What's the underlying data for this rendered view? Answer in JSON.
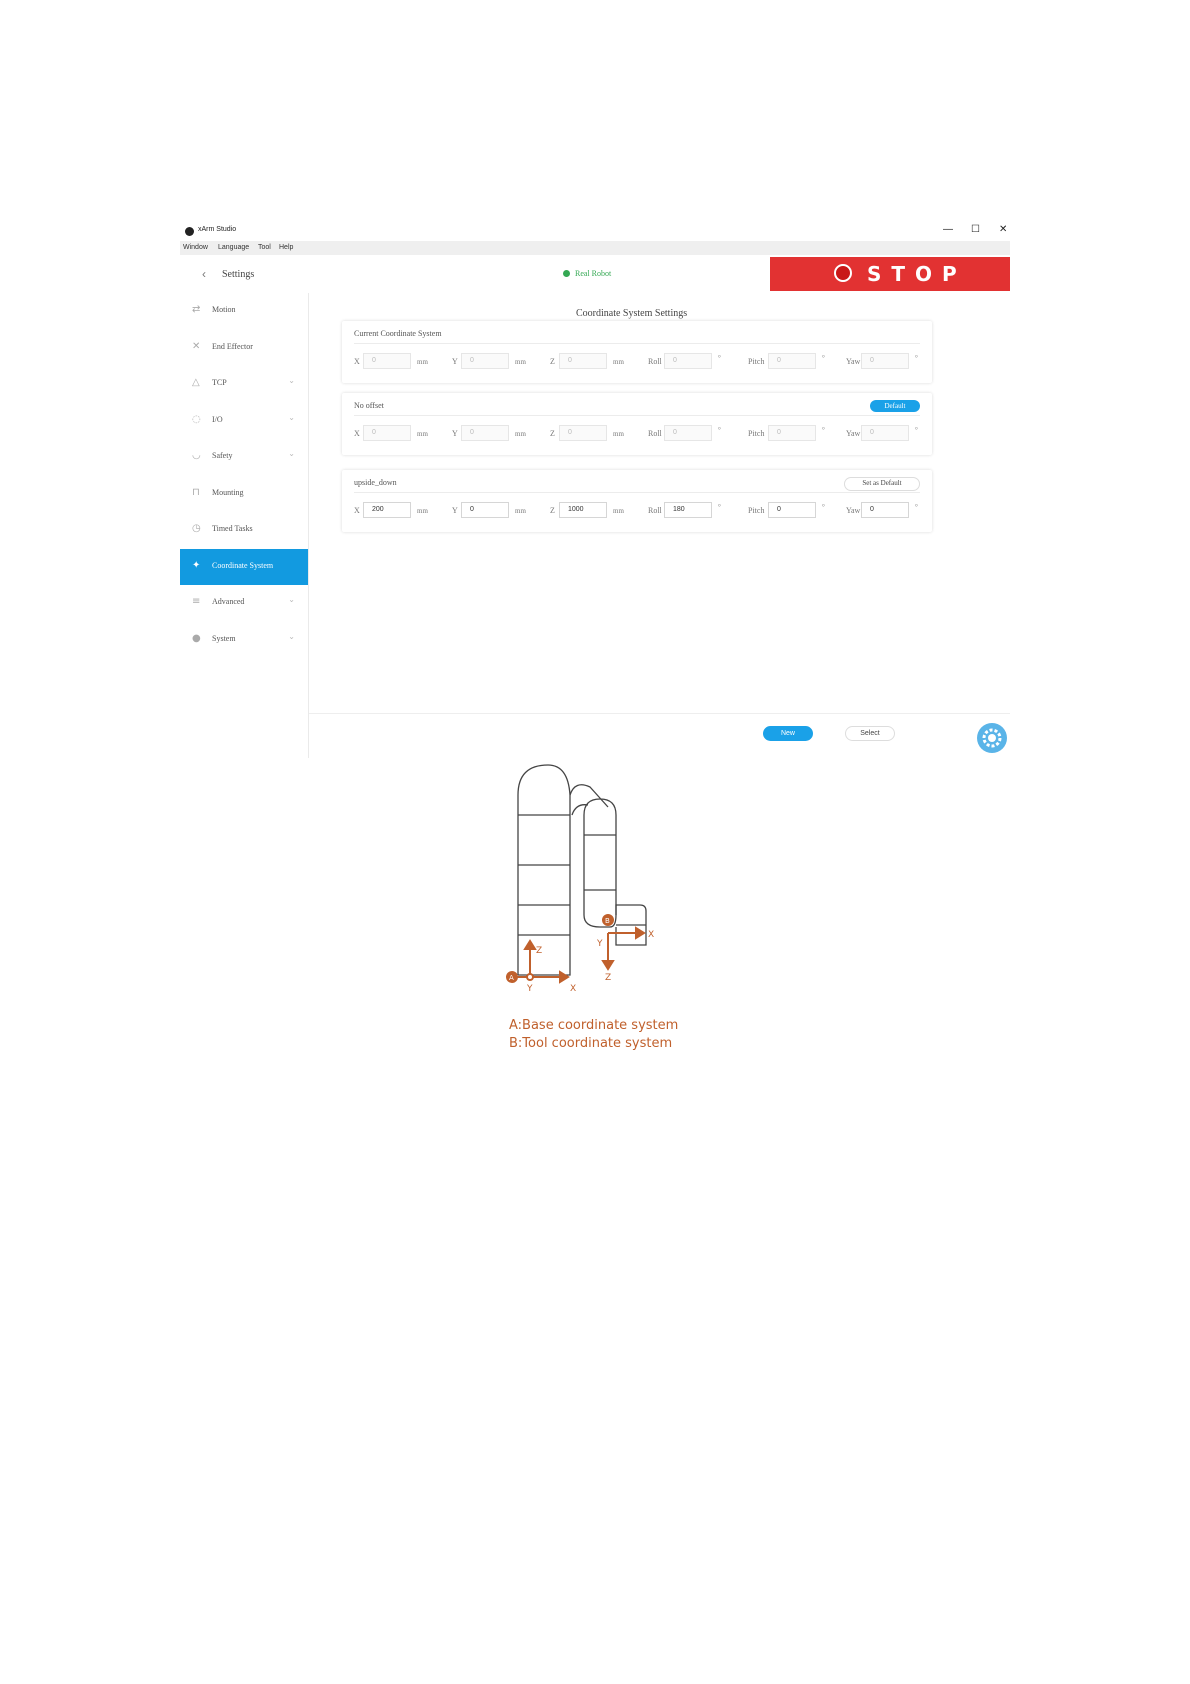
{
  "window": {
    "app_title": "xArm Studio",
    "minimize_glyph": "—",
    "maximize_glyph": "☐",
    "close_glyph": "✕"
  },
  "menu": [
    "Window",
    "Language",
    "Tool",
    "Help"
  ],
  "header": {
    "back_glyph": "‹",
    "settings_label": "Settings",
    "status_text": "Real Robot",
    "stop_label": "STOP"
  },
  "sidebar": {
    "items": [
      {
        "label": "Motion",
        "icon": "motion-icon",
        "chevron": false,
        "active": false
      },
      {
        "label": "End Effector",
        "icon": "end-effector-icon",
        "chevron": false,
        "active": false
      },
      {
        "label": "TCP",
        "icon": "tcp-icon",
        "chevron": true,
        "active": false
      },
      {
        "label": "I/O",
        "icon": "io-icon",
        "chevron": true,
        "active": false
      },
      {
        "label": "Safety",
        "icon": "safety-icon",
        "chevron": true,
        "active": false
      },
      {
        "label": "Mounting",
        "icon": "mounting-icon",
        "chevron": false,
        "active": false
      },
      {
        "label": "Timed Tasks",
        "icon": "clock-icon",
        "chevron": false,
        "active": false
      },
      {
        "label": "Coordinate System",
        "icon": "coordinate-icon",
        "chevron": false,
        "active": true
      },
      {
        "label": "Advanced",
        "icon": "advanced-icon",
        "chevron": true,
        "active": false
      },
      {
        "label": "System",
        "icon": "info-icon",
        "chevron": true,
        "active": false
      }
    ]
  },
  "main": {
    "title": "Coordinate System Settings",
    "cards": [
      {
        "title": "Current Coordinate System",
        "button": "",
        "fields": [
          {
            "label": "X",
            "value": "0",
            "unit": "mm"
          },
          {
            "label": "Y",
            "value": "0",
            "unit": "mm"
          },
          {
            "label": "Z",
            "value": "0",
            "unit": "mm"
          },
          {
            "label": "Roll",
            "value": "0",
            "unit": "°"
          },
          {
            "label": "Pitch",
            "value": "0",
            "unit": "°"
          },
          {
            "label": "Yaw",
            "value": "0",
            "unit": "°"
          }
        ]
      },
      {
        "title": "No offset",
        "button": "Default",
        "fields": [
          {
            "label": "X",
            "value": "0",
            "unit": "mm"
          },
          {
            "label": "Y",
            "value": "0",
            "unit": "mm"
          },
          {
            "label": "Z",
            "value": "0",
            "unit": "mm"
          },
          {
            "label": "Roll",
            "value": "0",
            "unit": "°"
          },
          {
            "label": "Pitch",
            "value": "0",
            "unit": "°"
          },
          {
            "label": "Yaw",
            "value": "0",
            "unit": "°"
          }
        ]
      },
      {
        "title": "upside_down",
        "button": "Set as Default",
        "fields": [
          {
            "label": "X",
            "value": "200",
            "unit": "mm"
          },
          {
            "label": "Y",
            "value": "0",
            "unit": "mm"
          },
          {
            "label": "Z",
            "value": "1000",
            "unit": "mm"
          },
          {
            "label": "Roll",
            "value": "180",
            "unit": "°"
          },
          {
            "label": "Pitch",
            "value": "0",
            "unit": "°"
          },
          {
            "label": "Yaw",
            "value": "0",
            "unit": "°"
          }
        ]
      }
    ],
    "new_button": "New",
    "select_button": "Select"
  },
  "diagram": {
    "base_marker": "A",
    "tool_marker": "B",
    "base_axes": {
      "z": "Z",
      "x": "X",
      "y": "Y"
    },
    "tool_axes": {
      "x": "X",
      "y": "Y",
      "z": "Z"
    },
    "caption_line1": "A:Base coordinate system",
    "caption_line2": "B:Tool coordinate system",
    "accent_color": "#c0602c"
  },
  "colors": {
    "accent_blue": "#129ae0",
    "stop_red": "#e23232",
    "status_green": "#34a853"
  }
}
